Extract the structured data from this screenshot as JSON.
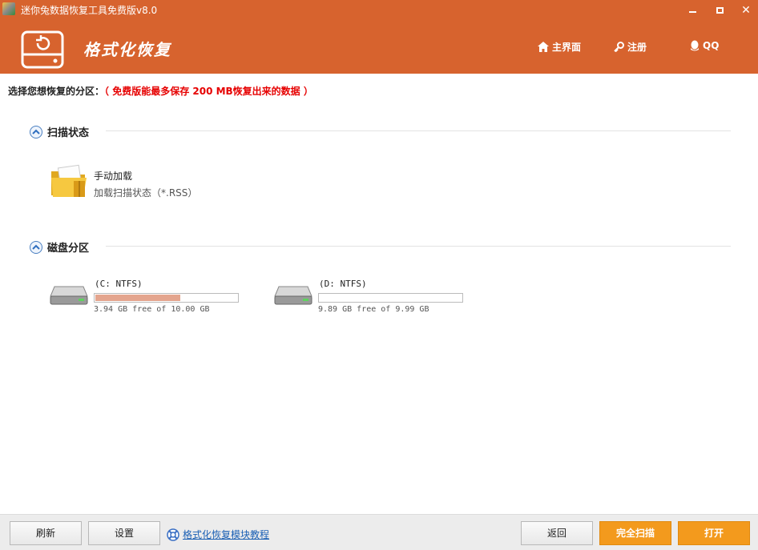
{
  "window": {
    "title": "迷你兔数据恢复工具免费版v8.0",
    "minimize_label": "",
    "maximize_label": "",
    "close_label": "✕"
  },
  "header": {
    "module_title": "格式化恢复",
    "nav": {
      "home": "主界面",
      "register": "注册",
      "qq": "QQ"
    }
  },
  "hint": {
    "label": "选择您想恢复的分区：",
    "notice": "（ 免费版能最多保存 200 MB恢复出来的数据 ）"
  },
  "scan_section": {
    "title": "扫描状态",
    "item": {
      "title": "手动加载",
      "subtitle": "加载扫描状态（*.RSS）"
    }
  },
  "partition_section": {
    "title": "磁盘分区",
    "drives": [
      {
        "name": "(C: NTFS)",
        "info": "3.94 GB free of 10.00 GB",
        "used_fraction": 0.606
      },
      {
        "name": "(D: NTFS)",
        "info": "9.89 GB free of 9.99 GB",
        "used_fraction": 0.01
      }
    ]
  },
  "footer": {
    "refresh": "刷新",
    "settings": "设置",
    "tutorial": "格式化恢复模块教程",
    "back": "返回",
    "full_scan": "完全扫描",
    "open": "打开"
  },
  "colors": {
    "header_bg": "#d7632e",
    "accent_button": "#f39a1d",
    "notice_red": "#e60000",
    "usage_fill": "#e4a58e"
  },
  "icons": [
    "app-icon",
    "drive-logo-icon",
    "home-icon",
    "key-icon",
    "qq-penguin-icon",
    "chevron-up-icon",
    "folder-icon",
    "hard-disk-icon",
    "lifebuoy-icon"
  ]
}
